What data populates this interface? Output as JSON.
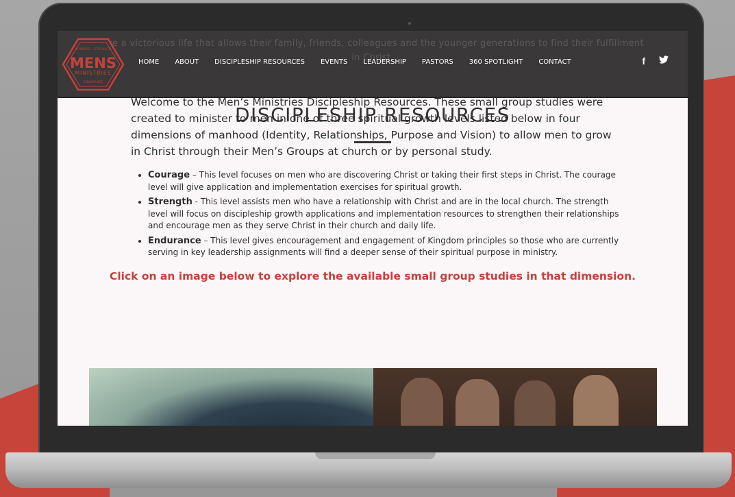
{
  "site": {
    "ghost_text": "live a victorious life that allows their family, friends, colleagues and the younger generations to find their fulfillment in Christ.",
    "logo": {
      "top_ring": "COURAGE • STRENGTH",
      "main": "MENS",
      "sub": "MINISTRIES",
      "bottom_ring": "ENDURANCE"
    },
    "nav": [
      "HOME",
      "ABOUT",
      "DISCIPLESHIP RESOURCES",
      "EVENTS",
      "LEADERSHIP",
      "PASTORS",
      "360 SPOTLIGHT",
      "CONTACT"
    ],
    "social": {
      "facebook": "f",
      "twitter": "🐦"
    }
  },
  "page": {
    "title": "DISCIPLESHIP RESOURCES",
    "intro": "Welcome to the Men’s Ministries Discipleship Resources. These small group studies were created to minister to men in one of three spiritual growth levels listed below in four dimensions of manhood (Identity, Relationships, Purpose and Vision) to allow men to grow in Christ through their Men’s Groups at church or by personal study.",
    "levels": [
      {
        "name": "Courage",
        "text": " – This level focuses on men who are discovering Christ or taking their first steps in Christ. The courage level will give application and implementation exercises for spiritual growth."
      },
      {
        "name": "Strength",
        "text": " - This level assists men who have a relationship with Christ and are in the local church. The strength level will focus on discipleship growth applications and implementation resources to strengthen their relationships and encourage men as they serve Christ in their church and daily life."
      },
      {
        "name": "Endurance",
        "text": " – This level gives encouragement and engagement of Kingdom principles so those who are currently serving in key leadership assignments will find a deeper sense of their spiritual purpose in ministry."
      }
    ],
    "cta": "Click on an image below to explore the available small group studies in that dimension."
  },
  "colors": {
    "accent": "#c4423a",
    "header": "#3a3838",
    "page_bg": "#fbf7f9",
    "bezel": "#2b2b2b"
  }
}
